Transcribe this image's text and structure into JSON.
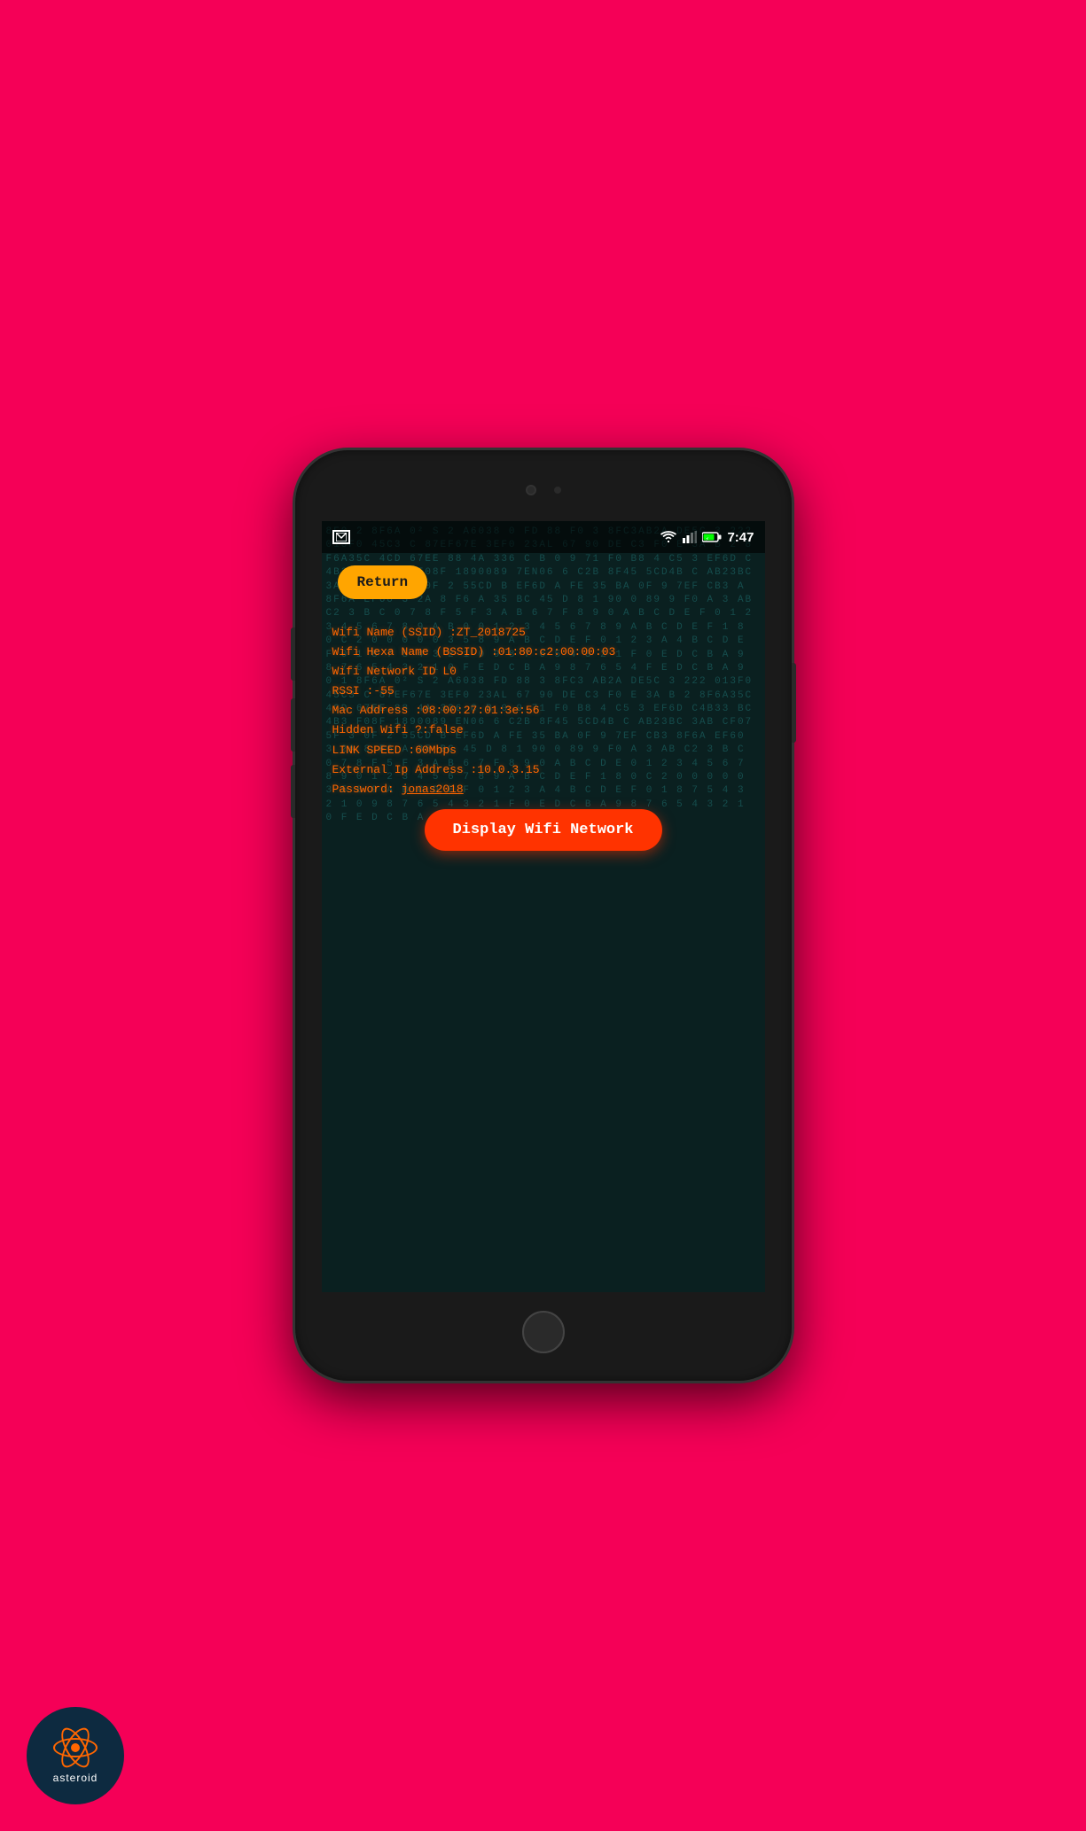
{
  "background": {
    "color": "#f50057"
  },
  "phone": {
    "status_bar": {
      "time": "7:47",
      "notification_icon": "image",
      "wifi_icon": "wifi",
      "signal_icon": "signal",
      "battery_icon": "battery"
    },
    "return_button": "Return",
    "wifi_info": {
      "ssid_label": "Wifi Name (SSID) :ZT_2018725",
      "bssid_label": "Wifi Hexa Name (BSSID) :01:80:c2:00:00:03",
      "network_id_label": "Wifi Network ID L0",
      "rssi_label": "RSSI :-55",
      "mac_label": "Mac Address :08:00:27:01:3e:56",
      "hidden_label": "Hidden Wifi ?:false",
      "link_speed_label": "LINK SPEED :60Mbps",
      "external_ip_label": "External Ip Address :10.0.3.15",
      "password_label": "Password: jonas2018"
    },
    "display_wifi_btn": "Display Wifi Network",
    "hex_background_sample": "8F0 2 8F6A\\0² S 2 A6038 0 FD 88 F0 3 8FC3AB2A DE5C 3 222 013F0 45C3 C 87EF67E 3EF0 23AL 67 90 DE C3 F0 E 3A B 2 8F6A35C 4CD 67EE 88 4A 336 C B 0 9 71 F0 B8 4 C5 3 EF6D C4B33 4BC4B3 F08F 1890089 7EN06 6 C2B 8F45 5CD4B C AB23BC 3AB CF075F 3 0F 2 55CD B EF6D A FE 35 BA"
  },
  "asteroid": {
    "label": "asteroid"
  }
}
